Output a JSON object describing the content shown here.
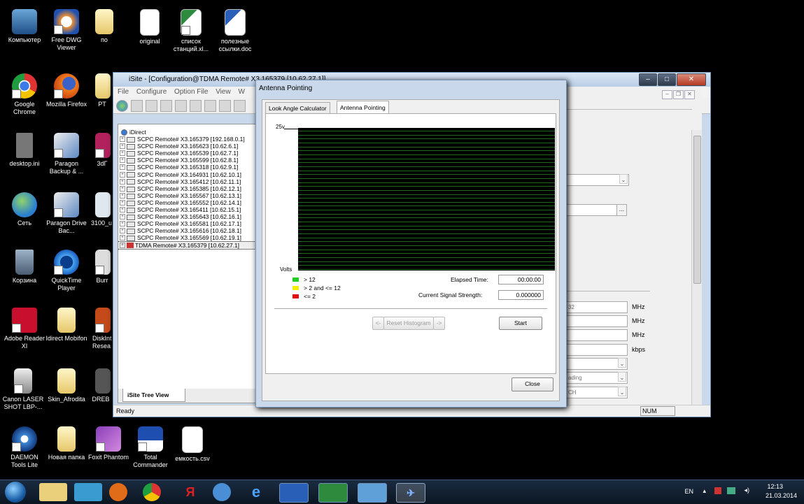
{
  "desktop": {
    "icons": [
      {
        "label": "Компьютер"
      },
      {
        "label": "Free DWG Viewer"
      },
      {
        "label": "по"
      },
      {
        "label": "original"
      },
      {
        "label": "список станций.xl..."
      },
      {
        "label": "полезные ссылки.doc"
      },
      {
        "label": "Google Chrome"
      },
      {
        "label": "Mozilla Firefox"
      },
      {
        "label": "PT"
      },
      {
        "label": "desktop.ini"
      },
      {
        "label": "Paragon Backup & ..."
      },
      {
        "label": "3dГ"
      },
      {
        "label": "Сеть"
      },
      {
        "label": "Paragon Drive Bac..."
      },
      {
        "label": "3100_u"
      },
      {
        "label": "Корзина"
      },
      {
        "label": "QuickTime Player"
      },
      {
        "label": "Burr"
      },
      {
        "label": "Adobe Reader XI"
      },
      {
        "label": "Idirect Mobifon"
      },
      {
        "label": "DiskInt Resea"
      },
      {
        "label": "Canon LASER SHOT LBP-..."
      },
      {
        "label": "Skin_Afrodita"
      },
      {
        "label": "DREB"
      },
      {
        "label": "DAEMON Tools Lite"
      },
      {
        "label": "Новая папка"
      },
      {
        "label": "Foxit Phantom"
      },
      {
        "label": "Total Commander"
      },
      {
        "label": "емкость.csv"
      }
    ]
  },
  "isite": {
    "title": "iSite - [Configuration@TDMA Remote# X3.165379 [10.62.27.1]]",
    "menu": [
      "File",
      "Configure",
      "Option File",
      "View",
      "W"
    ],
    "tree": {
      "root": "iDirect",
      "items": [
        "SCPC Remote# X3.165379 [192.168.0.1]",
        "SCPC Remote# X3.165623 [10.62.6.1]",
        "SCPC Remote# X3.165539 [10.62.7.1]",
        "SCPC Remote# X3.165599 [10.62.8.1]",
        "SCPC Remote# X3.165318 [10.62.9.1]",
        "SCPC Remote# X3.164931 [10.62.10.1]",
        "SCPC Remote# X3.165412 [10.62.11.1]",
        "SCPC Remote# X3.165385 [10.62.12.1]",
        "SCPC Remote# X3.165567 [10.62.13.1]",
        "SCPC Remote# X3.165552 [10.62.14.1]",
        "SCPC Remote# X3.165411 [10.62.15.1]",
        "SCPC Remote# X3.165643 [10.62.16.1]",
        "SCPC Remote# X3.165581 [10.62.17.1]",
        "SCPC Remote# X3.165616 [10.62.18.1]",
        "SCPC Remote# X3.165569 [10.62.19.1]"
      ],
      "selected": "TDMA Remote# X3.165379 [10.62.27.1]"
    },
    "tree_tab": "iSite Tree View",
    "status": "Ready",
    "num": "NUM",
    "right": {
      "field_32": "32",
      "units": [
        "MHz",
        "MHz",
        "MHz",
        "kbps"
      ],
      "dd1": "ading",
      "dd2": "CH"
    }
  },
  "dialog": {
    "title": "Antenna Pointing",
    "tabs": [
      "Look Angle Calculator",
      "Antenna Pointing"
    ],
    "active_tab": "Antenna Pointing",
    "y_top_label": "25v",
    "y_unit_label": "Volts",
    "legend": [
      {
        "label": "> 12",
        "color": "#22cc22"
      },
      {
        "label": "> 2 and <= 12",
        "color": "#f0f000"
      },
      {
        "label": "<= 2",
        "color": "#e01010"
      }
    ],
    "elapsed_label": "Elapsed Time:",
    "elapsed_value": "00:00:00",
    "signal_label": "Current Signal Strength:",
    "signal_value": "0.000000",
    "prev_label": "<-",
    "reset_label": "Reset Histogram",
    "next_label": "->",
    "start_label": "Start",
    "close_label": "Close",
    "histogram": {
      "gridline_count": 36,
      "gridline_color": "#1f6a1f"
    }
  },
  "taskbar": {
    "lang": "EN",
    "time": "12:13",
    "date": "21.03.2014"
  }
}
